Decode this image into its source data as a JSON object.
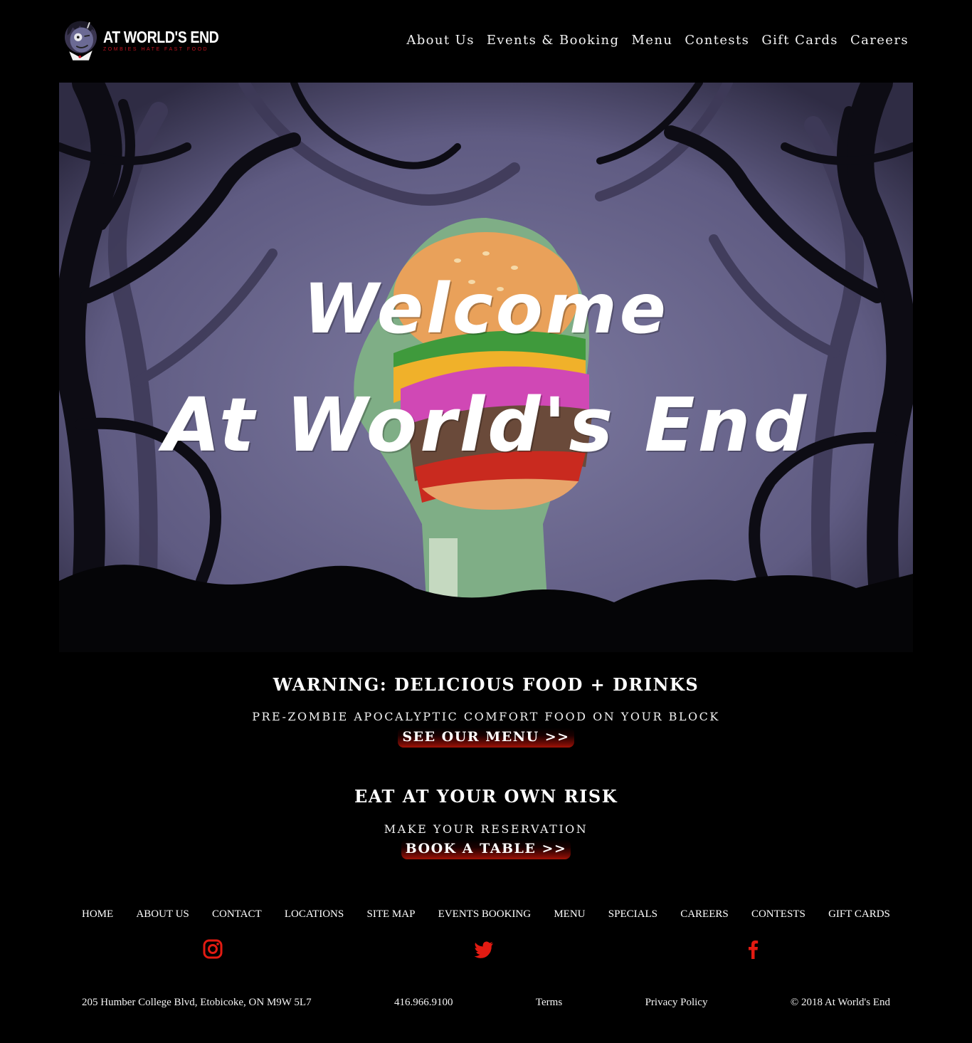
{
  "brand": {
    "name": "AT WORLD'S END",
    "tagline": "ZOMBIES HATE FAST FOOD"
  },
  "nav": {
    "items": [
      "About Us",
      "Events & Booking",
      "Menu",
      "Contests",
      "Gift Cards",
      "Careers"
    ]
  },
  "hero": {
    "line1": "Welcome",
    "line2": "At World's End",
    "sky_color": "#6e6a92"
  },
  "promo1": {
    "heading": "WARNING: DELICIOUS FOOD + DRINKS",
    "subheading": "PRE-ZOMBIE APOCALYPTIC COMFORT FOOD ON YOUR BLOCK",
    "button": "SEE OUR MENU >>"
  },
  "promo2": {
    "heading": "EAT AT YOUR OWN RISK",
    "subheading": "MAKE YOUR RESERVATION",
    "button": "BOOK A TABLE >>"
  },
  "footer": {
    "links": [
      "HOME",
      "ABOUT US",
      "CONTACT",
      "LOCATIONS",
      "SITE MAP",
      "EVENTS BOOKING",
      "MENU",
      "SPECIALS",
      "CAREERS",
      "CONTESTS",
      "GIFT CARDS"
    ],
    "social": [
      "instagram-icon",
      "twitter-icon",
      "facebook-icon"
    ],
    "social_color": "#e31b12",
    "address": "205 Humber College Blvd, Etobicoke, ON M9W 5L7",
    "phone": "416.966.9100",
    "terms": "Terms",
    "privacy": "Privacy Policy",
    "copyright": "© 2018 At World's End"
  }
}
